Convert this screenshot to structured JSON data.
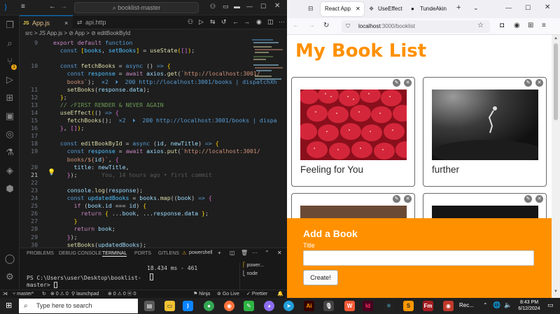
{
  "vscode": {
    "search_text": "booklist-master",
    "tabs": [
      {
        "label": "App.js",
        "badge": "JS",
        "active": true
      },
      {
        "label": "api.http",
        "badge": "",
        "active": false
      }
    ],
    "breadcrumb": "src > JS App.js > ⊘ App > ⊘ editBookById",
    "code_lines": [
      {
        "num": "9",
        "html": "<span class='kwc'>export default</span> <span class='kw'>function</span>"
      },
      {
        "num": "",
        "html": "  <span class='kw'>const</span> <span class='brk'>[</span><span class='cnst'>books</span>, <span class='cnst'>setBooks</span><span class='brk'>]</span> = <span class='fn'>useState</span><span class='brk'>(</span><span class='brk2'>[]</span><span class='brk'>)</span>;"
      },
      {
        "num": "",
        "html": ""
      },
      {
        "num": "10",
        "html": "  <span class='kw'>const</span> <span class='fn'>fetchBooks</span> = <span class='kw'>async</span> () <span class='kw'>=></span> <span class='brk'>{</span>"
      },
      {
        "num": "",
        "html": "    <span class='kw'>const</span> <span class='cnst'>response</span> = <span class='kwc'>await</span> <span class='var'>axios</span>.<span class='fn'>get</span>(<span class='str'>`http://localhost:3001/</span>"
      },
      {
        "num": "",
        "html": "    <span class='str'>books`</span>);  <span class='inl'>×2  ⏵  200 http://localhost:3001/books | dispatchXh</span>"
      },
      {
        "num": "11",
        "html": "    <span class='fn'>setBooks</span>(<span class='var'>response</span>.<span class='var'>data</span>);"
      },
      {
        "num": "12",
        "html": "  <span class='brk'>}</span>;"
      },
      {
        "num": "13",
        "html": "  <span class='cmt'>// ✓FIRST RENDER &amp; NEVER AGAIN</span>"
      },
      {
        "num": "14",
        "html": "  <span class='fn'>useEffect</span><span class='brk'>(</span>() <span class='kw'>=></span> <span class='brk2'>{</span>"
      },
      {
        "num": "15",
        "html": "    <span class='fn'>fetchBooks</span>();  <span class='inl'>×2  ⏵  200 http://localhost:3001/books | dispa</span>"
      },
      {
        "num": "16",
        "html": "  <span class='brk2'>}</span>, <span class='brk2'>[]</span><span class='brk'>)</span>;"
      },
      {
        "num": "17",
        "html": ""
      },
      {
        "num": "18",
        "html": "  <span class='kw'>const</span> <span class='fn'>editBookById</span> = <span class='kw'>async</span> (<span class='var'>id</span>, <span class='var'>newTitle</span>) <span class='kw'>=></span> <span class='brk'>{</span>"
      },
      {
        "num": "19",
        "html": "    <span class='kw'>const</span> <span class='cnst'>response</span> = <span class='kwc'>await</span> <span class='var'>axios</span>.<span class='fn'>put</span>(<span class='str'>`http://localhost:3001/</span>"
      },
      {
        "num": "",
        "html": "    <span class='str'>books/${</span><span class='var'>id</span><span class='str'>}`</span>, <span class='brk2'>{</span>"
      },
      {
        "num": "20",
        "html": "      <span class='var'>title</span>: <span class='var'>newTitle</span>,"
      },
      {
        "num": "21",
        "html": "    <span class='brk2'>}</span>);       <span class='dim'>You, 14 hours ago • first commit</span>"
      },
      {
        "num": "22",
        "html": ""
      },
      {
        "num": "23",
        "html": "    <span class='var'>console</span>.<span class='fn'>log</span>(<span class='var'>response</span>);"
      },
      {
        "num": "24",
        "html": "    <span class='kw'>const</span> <span class='cnst'>updatedBooks</span> = <span class='var'>books</span>.<span class='fn'>map</span>((<span class='var'>book</span>) <span class='kw'>=></span> <span class='brk2'>{</span>"
      },
      {
        "num": "25",
        "html": "      <span class='kwc'>if</span> (<span class='var'>book</span>.<span class='var'>id</span> === <span class='var'>id</span>) <span class='brk'>{</span>"
      },
      {
        "num": "26",
        "html": "        <span class='kwc'>return</span> <span class='brk'>{</span> ...<span class='var'>book</span>, ...<span class='var'>response</span>.<span class='var'>data</span> <span class='brk'>}</span>;"
      },
      {
        "num": "27",
        "html": "      <span class='brk'>}</span>"
      },
      {
        "num": "28",
        "html": "      <span class='kwc'>return</span> <span class='var'>book</span>;"
      },
      {
        "num": "29",
        "html": "    <span class='brk2'>}</span>);"
      },
      {
        "num": "30",
        "html": "    <span class='fn'>setBooks</span>(<span class='var'>updatedBooks</span>);"
      }
    ],
    "panel_tabs": [
      "PROBLEMS",
      "DEBUG CONSOLE",
      "TERMINAL",
      "PORTS",
      "GITLENS"
    ],
    "active_panel_tab": "TERMINAL",
    "terminal_name": "powershell",
    "terminal_side": [
      "power...",
      "node"
    ],
    "terminal_timing": "18.434 ms - 461",
    "terminal_prompt": "PS C:\\Users\\user\\Desktop\\booklist-\nmaster> ",
    "status": {
      "branch": "master*",
      "errors": "⊗ 0 ⚠ 0",
      "launch": "launchpad",
      "ports": "⊗ 0 ⚠ 0 ⓦ 0",
      "ninja": "Ninja",
      "golive": "Go Live",
      "prettier": "Prettier"
    }
  },
  "firefox": {
    "tabs": [
      {
        "label": "React App",
        "active": true
      },
      {
        "label": "UseEffect",
        "active": false
      },
      {
        "label": "TundeAkin",
        "active": false
      }
    ],
    "url_host": "localhost",
    "url_rest": ":3000/booklist",
    "page": {
      "title": "My Book List",
      "books": [
        {
          "title": "Feeling for You"
        },
        {
          "title": "further"
        },
        {
          "title": ""
        },
        {
          "title": ""
        }
      ],
      "form": {
        "heading": "Add a Book",
        "label": "Title",
        "input_value": "",
        "button": "Create!"
      }
    }
  },
  "taskbar": {
    "search_placeholder": "Type here to search",
    "rec_label": "Rec...",
    "time": "8:43 PM",
    "date": "6/12/2024"
  },
  "colors": {
    "accent_orange": "#ff9000",
    "vscode_bg": "#1e1e1e"
  }
}
